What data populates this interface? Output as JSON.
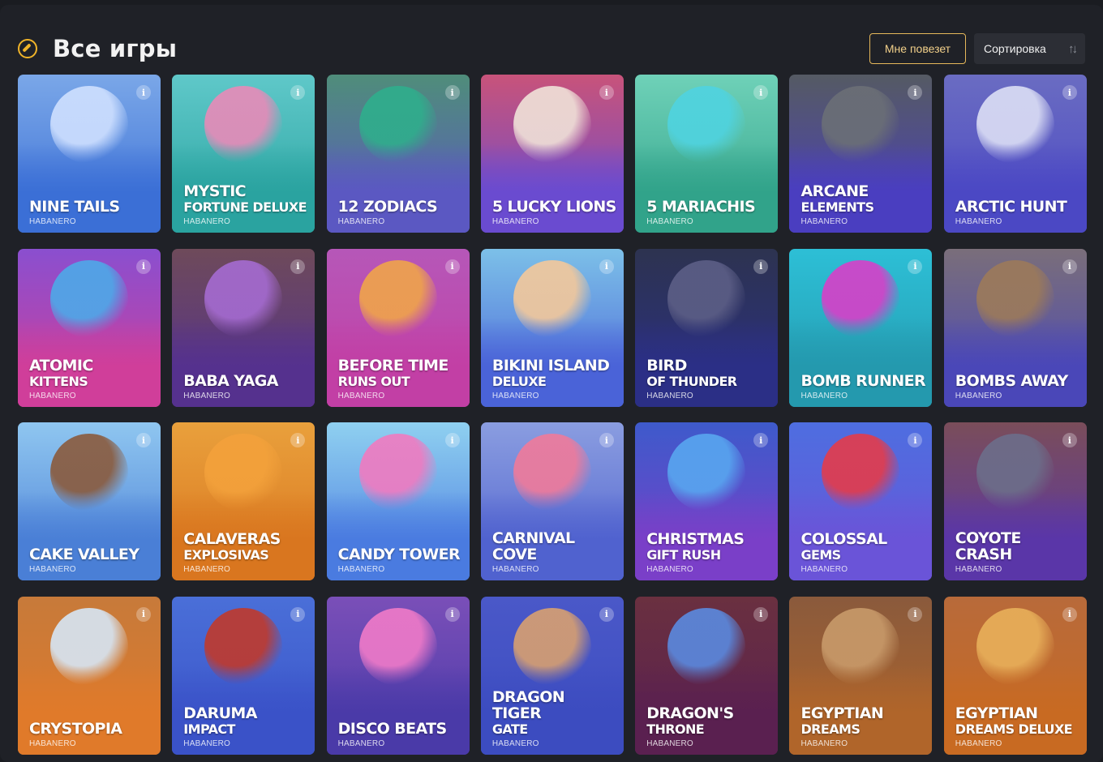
{
  "header": {
    "title": "Все игры",
    "lucky_label": "Мне повезет",
    "sort_label": "Сортировка",
    "icon": "compass-icon"
  },
  "info_glyph": "i",
  "games": [
    {
      "line1": "NINE TAILS",
      "line2": "",
      "provider": "HABANERO",
      "top": "#7aa7e8",
      "bottom": "#3b6fd6",
      "art": "#cfe0ff"
    },
    {
      "line1": "MYSTIC",
      "line2": "FORTUNE DELUXE",
      "provider": "HABANERO",
      "top": "#5fc8c9",
      "bottom": "#2aa3a0",
      "art": "#e88ab8"
    },
    {
      "line1": "12 ZODIACS",
      "line2": "",
      "provider": "HABANERO",
      "top": "#4f8d7a",
      "bottom": "#5b58c2",
      "art": "#2fae8c"
    },
    {
      "line1": "5 LUCKY LIONS",
      "line2": "",
      "provider": "HABANERO",
      "top": "#c8537a",
      "bottom": "#6a4bd0",
      "art": "#f0e2d8"
    },
    {
      "line1": "5 MARIACHIS",
      "line2": "",
      "provider": "HABANERO",
      "top": "#6fd1b8",
      "bottom": "#31a38a",
      "art": "#4fd3e0"
    },
    {
      "line1": "ARCANE",
      "line2": "ELEMENTS",
      "provider": "HABANERO",
      "top": "#555a63",
      "bottom": "#4a3ec0",
      "art": "#6b6f76"
    },
    {
      "line1": "ARCTIC HUNT",
      "line2": "",
      "provider": "HABANERO",
      "top": "#6a6cc2",
      "bottom": "#4b48c4",
      "art": "#dcdff5"
    },
    {
      "line1": "ATOMIC",
      "line2": "KITTENS",
      "provider": "HABANERO",
      "top": "#8a4fcf",
      "bottom": "#d03e9a",
      "art": "#4da9e8"
    },
    {
      "line1": "BABA YAGA",
      "line2": "",
      "provider": "HABANERO",
      "top": "#6e4a5a",
      "bottom": "#55318e",
      "art": "#a56bd1"
    },
    {
      "line1": "BEFORE TIME",
      "line2": "RUNS OUT",
      "provider": "HABANERO",
      "top": "#b657b8",
      "bottom": "#c23fa5",
      "art": "#f0a44a"
    },
    {
      "line1": "BIKINI ISLAND",
      "line2": "DELUXE",
      "provider": "HABANERO",
      "top": "#7cc0e8",
      "bottom": "#4a63d8",
      "art": "#f4c89a"
    },
    {
      "line1": "BIRD",
      "line2": "OF THUNDER",
      "provider": "HABANERO",
      "top": "#2d3350",
      "bottom": "#2b2f86",
      "art": "#5c5e86"
    },
    {
      "line1": "BOMB RUNNER",
      "line2": "",
      "provider": "HABANERO",
      "top": "#2dbfd6",
      "bottom": "#2499ae",
      "art": "#d73fc8"
    },
    {
      "line1": "BOMBS AWAY",
      "line2": "",
      "provider": "HABANERO",
      "top": "#7a6e7a",
      "bottom": "#4a47b8",
      "art": "#9c7a5a"
    },
    {
      "line1": "CAKE VALLEY",
      "line2": "",
      "provider": "HABANERO",
      "top": "#8fc6f0",
      "bottom": "#4a7fd6",
      "art": "#8a5a3c"
    },
    {
      "line1": "CALAVERAS",
      "line2": "EXPLOSIVAS",
      "provider": "HABANERO",
      "top": "#e9a03c",
      "bottom": "#d9761f",
      "art": "#f3a13b"
    },
    {
      "line1": "CANDY TOWER",
      "line2": "",
      "provider": "HABANERO",
      "top": "#8fd0f0",
      "bottom": "#4a7be0",
      "art": "#f07ac0"
    },
    {
      "line1": "CARNIVAL COVE",
      "line2": "",
      "provider": "HABANERO",
      "top": "#8a9de0",
      "bottom": "#5062cf",
      "art": "#f07a9a"
    },
    {
      "line1": "CHRISTMAS",
      "line2": "GIFT RUSH",
      "provider": "HABANERO",
      "top": "#3e5acb",
      "bottom": "#7a3fc8",
      "art": "#58a6f0"
    },
    {
      "line1": "COLOSSAL",
      "line2": "GEMS",
      "provider": "HABANERO",
      "top": "#4e6ee0",
      "bottom": "#6a54d8",
      "art": "#e43b4a"
    },
    {
      "line1": "COYOTE CRASH",
      "line2": "",
      "provider": "HABANERO",
      "top": "#7a4d5a",
      "bottom": "#5a36a8",
      "art": "#6c6e8a"
    },
    {
      "line1": "CRYSTOPIA",
      "line2": "",
      "provider": "HABANERO",
      "top": "#c77a3a",
      "bottom": "#e07a2a",
      "art": "#d6e6f5"
    },
    {
      "line1": "DARUMA",
      "line2": "IMPACT",
      "provider": "HABANERO",
      "top": "#4a6fd8",
      "bottom": "#3a52c8",
      "art": "#c0392b"
    },
    {
      "line1": "DISCO BEATS",
      "line2": "",
      "provider": "HABANERO",
      "top": "#7a4fb8",
      "bottom": "#4a3aa8",
      "art": "#f07ac8"
    },
    {
      "line1": "DRAGON TIGER",
      "line2": "GATE",
      "provider": "HABANERO",
      "top": "#4a58c8",
      "bottom": "#3c4cc0",
      "art": "#d8a070"
    },
    {
      "line1": "DRAGON'S",
      "line2": "THRONE",
      "provider": "HABANERO",
      "top": "#6a3040",
      "bottom": "#5a2050",
      "art": "#5a8ae0"
    },
    {
      "line1": "EGYPTIAN",
      "line2": "DREAMS",
      "provider": "HABANERO",
      "top": "#8a5a3c",
      "bottom": "#b0652a",
      "art": "#c89a6a"
    },
    {
      "line1": "EGYPTIAN",
      "line2": "DREAMS DELUXE",
      "provider": "HABANERO",
      "top": "#b86a3a",
      "bottom": "#c86a22",
      "art": "#e8b05a"
    }
  ]
}
